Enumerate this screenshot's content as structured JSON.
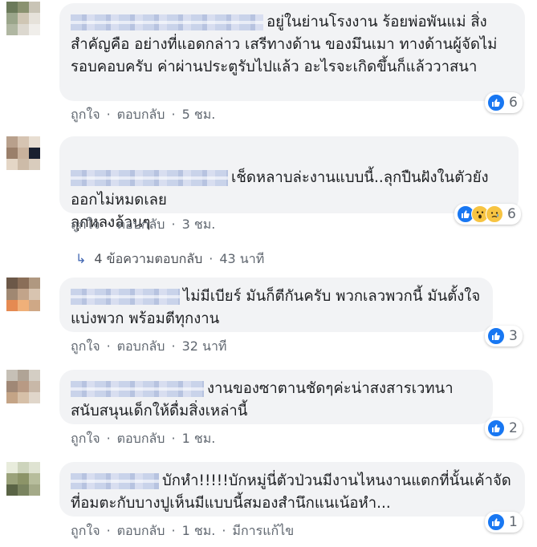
{
  "comments": [
    {
      "text": "อยู่ในย่านโรงงาน ร้อยพ่อพันแม่ สิ่งสำคัญคือ อย่างที่แอดกล่าว เสรีทางด้าน ของมึนเมา ทางด้านผู้จัดไม่รอบคอบครับ ค่าผ่านประตูรับไปแล้ว อะไรจะเกิดขึ้นก็แล้ววาสนา",
      "like_label": "ถูกใจ",
      "reply_label": "ตอบกลับ",
      "time": "5 ชม.",
      "reaction_count": "6",
      "reactions": [
        "like"
      ],
      "avatar_colors": [
        "#6b7a5a",
        "#8a9270",
        "#c9c4b6",
        "#9aa58a",
        "#cfc6b4",
        "#e6e2da",
        "#b0b7a2",
        "#dcd8cf",
        "#f0eeea"
      ]
    },
    {
      "text": "เช็ดหลาบล่ะงานแบบนี้..ลุกปืนฝังในตัวยังออกไม่หมดเลย\nลุกหลงล้วนๆ",
      "like_label": "ถูกใจ",
      "reply_label": "ตอบกลับ",
      "time": "3 ชม.",
      "reaction_count": "6",
      "reactions": [
        "like",
        "wow",
        "sad"
      ],
      "avatar_colors": [
        "#b8a08c",
        "#d6c4b2",
        "#e8ded2",
        "#9a7f6a",
        "#c8b19c",
        "#1a2030",
        "#e4d6c6",
        "#cdbba8",
        "#d9ccbd"
      ]
    },
    {
      "text": "ไม่มีเบียร์ มันก็ตีกันครับ พวกเลวพวกนี้ มันตั้งใจ แบ่งพวก พร้อมตีทุกงาน",
      "like_label": "ถูกใจ",
      "reply_label": "ตอบกลับ",
      "time": "32 นาที",
      "reaction_count": "3",
      "reactions": [
        "like"
      ],
      "avatar_colors": [
        "#6c5848",
        "#8a6e58",
        "#b09880",
        "#a08872",
        "#c2a48a",
        "#d8c4b0",
        "#e58a52",
        "#f0b079",
        "#cfa886"
      ]
    },
    {
      "text": "งานของซาตานชัดๆค่ะน่าสงสารเวทนาสนับสนุนเด็กให้ดื่มสิ่งเหล่านี้",
      "like_label": "ถูกใจ",
      "reply_label": "ตอบกลับ",
      "time": "1 ชม.",
      "reaction_count": "2",
      "reactions": [
        "like"
      ],
      "avatar_colors": [
        "#c6c0b6",
        "#b0a496",
        "#d4cec4",
        "#a08876",
        "#b89a84",
        "#c8b8a8",
        "#c4a486",
        "#d6c0a8",
        "#e0d6ca"
      ]
    },
    {
      "text": "บักหำ!!!!!บักหมู่นี่ตัวป่วนมีงานไหนงานแตกที่นั้นเค้าจัดที่อมตะกับบางปูเห็นมีแบบนี้สมองสำนึกแนเน้อหำ...",
      "like_label": "ถูกใจ",
      "reply_label": "ตอบกลับ",
      "time": "1 ชม.",
      "edited": "มีการแก้ไข",
      "reaction_count": "1",
      "reactions": [
        "like"
      ],
      "avatar_colors": [
        "#e8ecdc",
        "#cdd4bc",
        "#dfe3d2",
        "#9aa27a",
        "#8c9468",
        "#b7bd9c",
        "#5a6446",
        "#7a8460",
        "#a4aa88"
      ]
    }
  ],
  "replies_link": {
    "arrow": "↳",
    "count_text": "4 ข้อความตอบกลับ",
    "time": "43 นาที"
  }
}
